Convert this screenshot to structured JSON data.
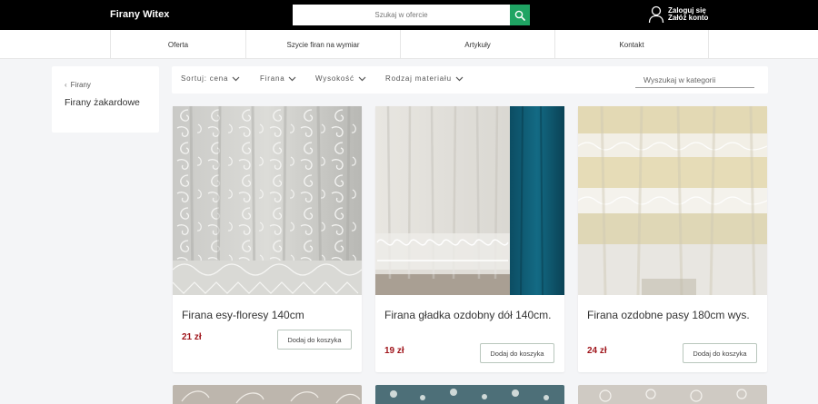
{
  "header": {
    "brand": "Firany Witex",
    "search_placeholder": "Szukaj w ofercie",
    "login": "Zaloguj się",
    "register": "Załóż konto"
  },
  "nav": {
    "items": [
      {
        "label": "Oferta"
      },
      {
        "label": "Szycie firan na wymiar"
      },
      {
        "label": "Artykuły"
      },
      {
        "label": "Kontakt"
      }
    ]
  },
  "sidebar": {
    "breadcrumb": "Firany",
    "category": "Firany żakardowe"
  },
  "filters": {
    "sort": "Sortuj: cena",
    "firana": "Firana",
    "height": "Wysokość",
    "material": "Rodzaj materiału",
    "category_search_placeholder": "Wyszukaj w kategorii"
  },
  "products": [
    {
      "title": "Firana esy-floresy 140cm",
      "price": "21 zł",
      "button": "Dodaj do koszyka"
    },
    {
      "title": "Firana gładka ozdobny dół 140cm.",
      "price": "19 zł",
      "button": "Dodaj do koszyka"
    },
    {
      "title": "Firana ozdobne pasy 180cm wys.",
      "price": "24 zł",
      "button": "Dodaj do koszyka"
    }
  ],
  "colors": {
    "topbar": "#000000",
    "search_button": "#1fa463",
    "price": "#a0161c",
    "curtain_blue": "#0f5a72"
  }
}
